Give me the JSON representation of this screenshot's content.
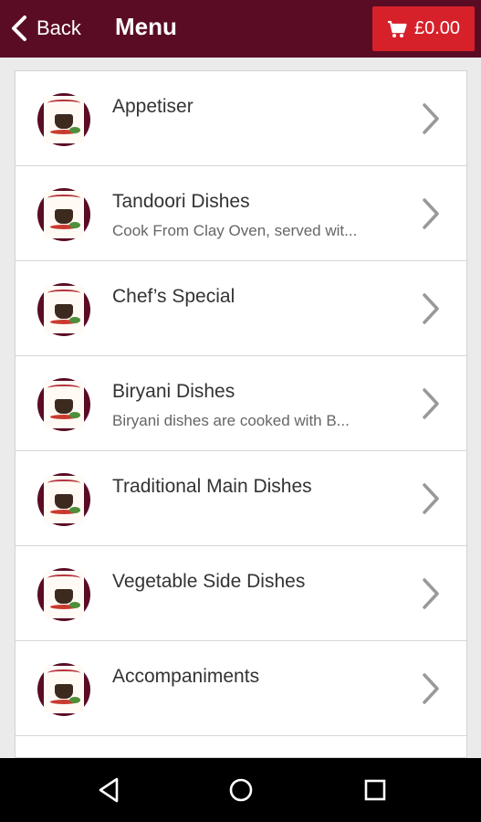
{
  "header": {
    "back_label": "Back",
    "title": "Menu",
    "cart_label": "£0.00"
  },
  "menu": {
    "items": [
      {
        "title": "Appetiser",
        "subtitle": ""
      },
      {
        "title": "Tandoori Dishes",
        "subtitle": "Cook From Clay Oven, served wit..."
      },
      {
        "title": "Chef’s Special",
        "subtitle": ""
      },
      {
        "title": "Biryani Dishes",
        "subtitle": "Biryani dishes are cooked with B..."
      },
      {
        "title": "Traditional Main Dishes",
        "subtitle": ""
      },
      {
        "title": "Vegetable Side Dishes",
        "subtitle": ""
      },
      {
        "title": "Accompaniments",
        "subtitle": ""
      },
      {
        "title": "",
        "subtitle": ""
      }
    ]
  },
  "icons": {
    "back": "chevron-left-icon",
    "cart": "cart-icon",
    "item_arrow": "chevron-right-icon",
    "item_logo": "restaurant-logo",
    "nav_back": "triangle-back-icon",
    "nav_home": "circle-home-icon",
    "nav_recents": "square-recents-icon"
  },
  "colors": {
    "appbar": "#5b0c25",
    "cart_button": "#d6212a",
    "background": "#ebebeb",
    "navbar": "#000000"
  }
}
